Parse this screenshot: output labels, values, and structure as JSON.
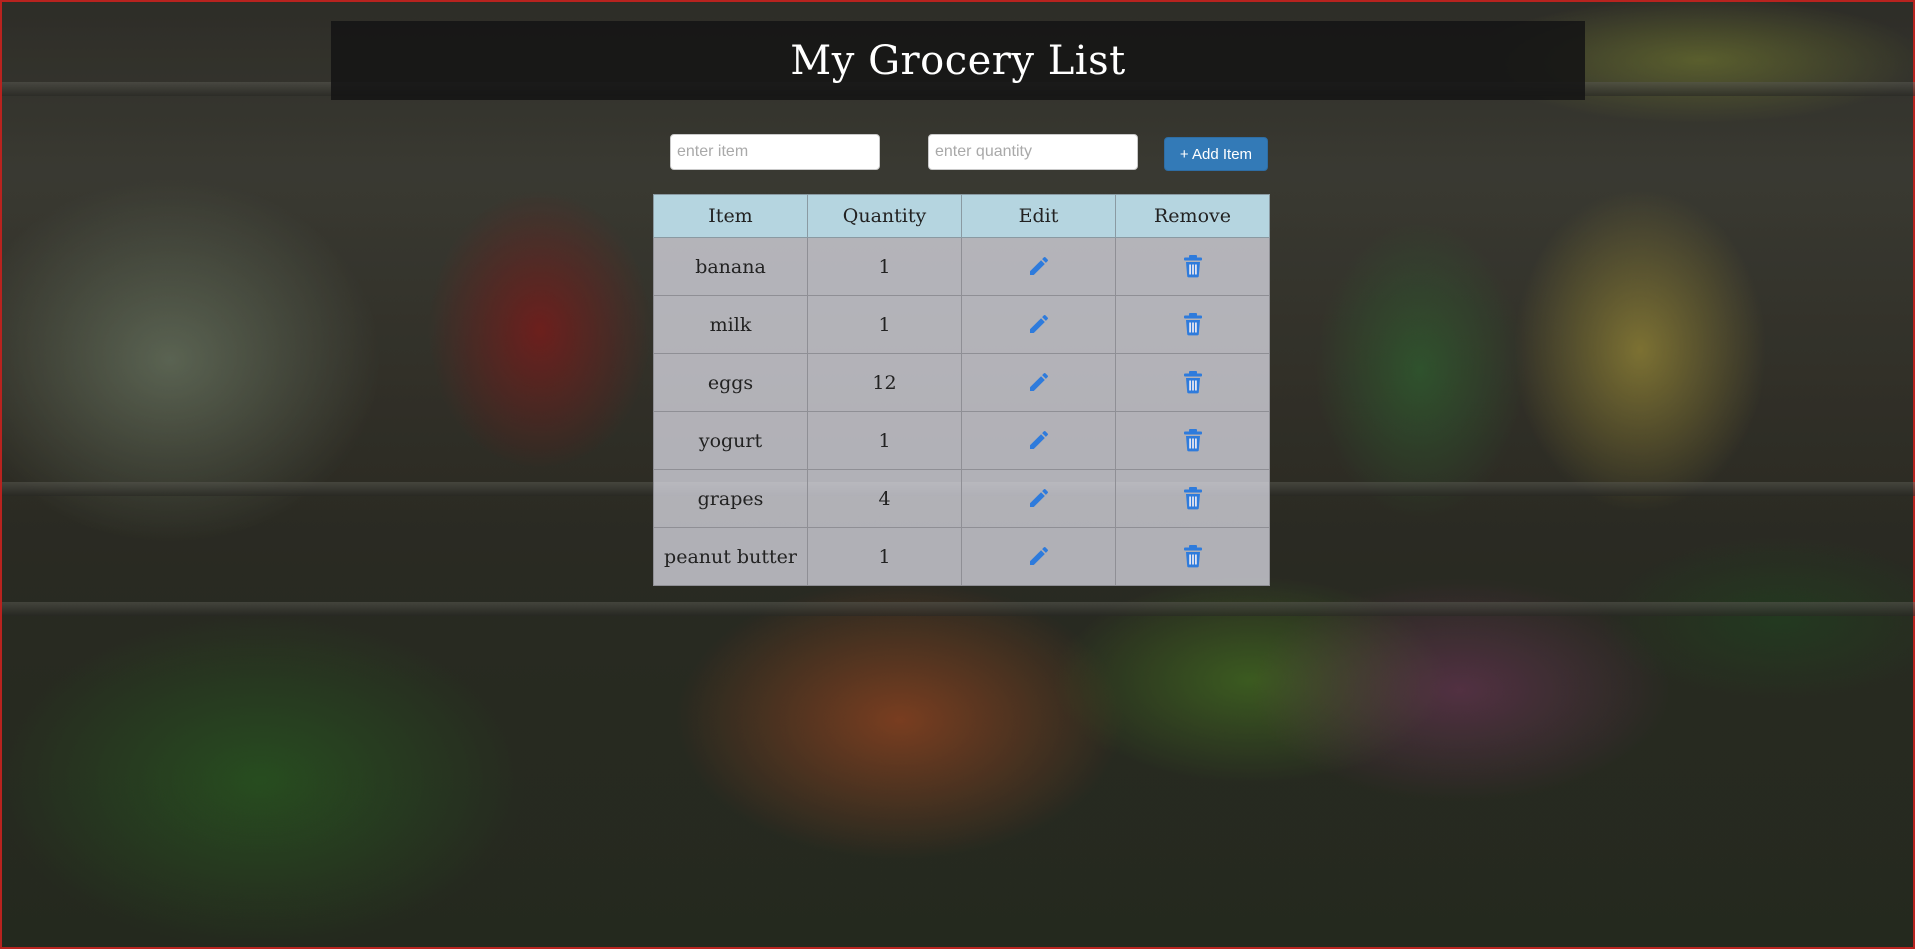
{
  "header": {
    "title": "My Grocery List"
  },
  "form": {
    "item_placeholder": "enter item",
    "quantity_placeholder": "enter quantity",
    "add_button_label": "+ Add Item"
  },
  "table": {
    "columns": [
      "Item",
      "Quantity",
      "Edit",
      "Remove"
    ],
    "rows": [
      {
        "item": "banana",
        "quantity": "1",
        "edit_icon": "pencil-icon",
        "remove_icon": "trash-icon"
      },
      {
        "item": "milk",
        "quantity": "1",
        "edit_icon": "pencil-icon",
        "remove_icon": "trash-icon"
      },
      {
        "item": "eggs",
        "quantity": "12",
        "edit_icon": "pencil-icon",
        "remove_icon": "trash-icon"
      },
      {
        "item": "yogurt",
        "quantity": "1",
        "edit_icon": "pencil-icon",
        "remove_icon": "trash-icon"
      },
      {
        "item": "grapes",
        "quantity": "4",
        "edit_icon": "pencil-icon",
        "remove_icon": "trash-icon"
      },
      {
        "item": "peanut butter",
        "quantity": "1",
        "edit_icon": "pencil-icon",
        "remove_icon": "trash-icon"
      }
    ]
  },
  "colors": {
    "accent": "#337ab7",
    "icon": "#2e7bdc",
    "header_bg": "#141414",
    "table_header_bg": "#bee1ee"
  }
}
